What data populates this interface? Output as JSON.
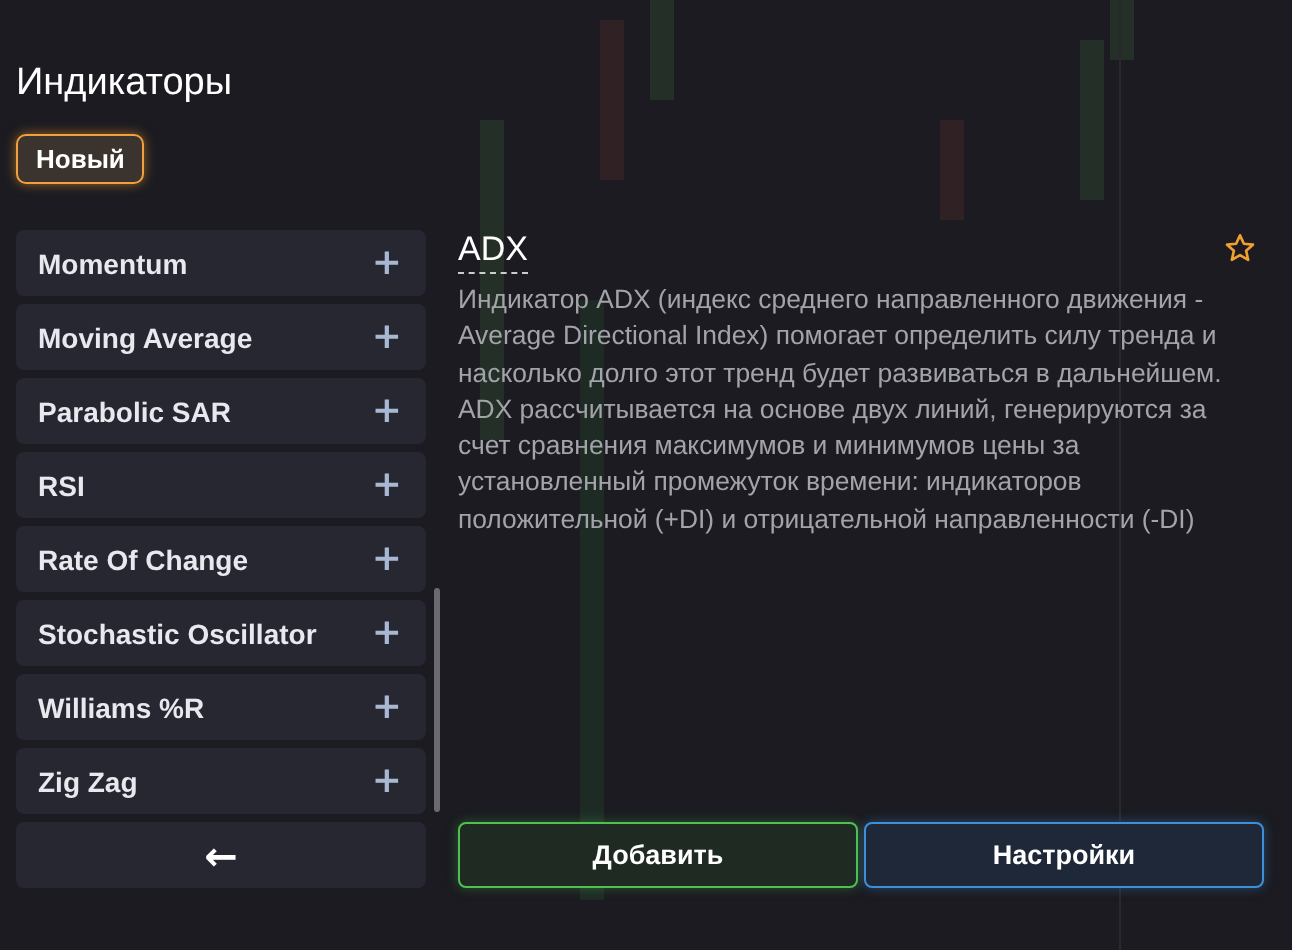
{
  "panel_title": "Индикаторы",
  "new_button": {
    "label": "Новый",
    "selected": true
  },
  "indicators": [
    {
      "label": "Momentum",
      "add": "+"
    },
    {
      "label": "Moving Average",
      "add": "+"
    },
    {
      "label": "Parabolic SAR",
      "add": "+"
    },
    {
      "label": "RSI",
      "add": "+"
    },
    {
      "label": "Rate Of Change",
      "add": "+"
    },
    {
      "label": "Stochastic Oscillator",
      "add": "+"
    },
    {
      "label": "Williams %R",
      "add": "+"
    },
    {
      "label": "Zig Zag",
      "add": "+"
    }
  ],
  "back_button": "←",
  "detail": {
    "title": "ADX",
    "favorite": false,
    "description": "Индикатор ADX (индекс среднего направленного движения - Average Directional Index) помогает определить силу тренда и насколько долго этот тренд будет развиваться в дальнейшем. ADX рассчитывается на основе двух линий, генерируются за счет сравнения максимумов и минимумов цены за установленный промежуток времени: индикаторов положительной (+DI) и отрицательной направленности (-DI)"
  },
  "actions": [
    {
      "label": "Добавить",
      "kind": "primary"
    },
    {
      "label": "Настройки",
      "kind": "secondary"
    }
  ]
}
